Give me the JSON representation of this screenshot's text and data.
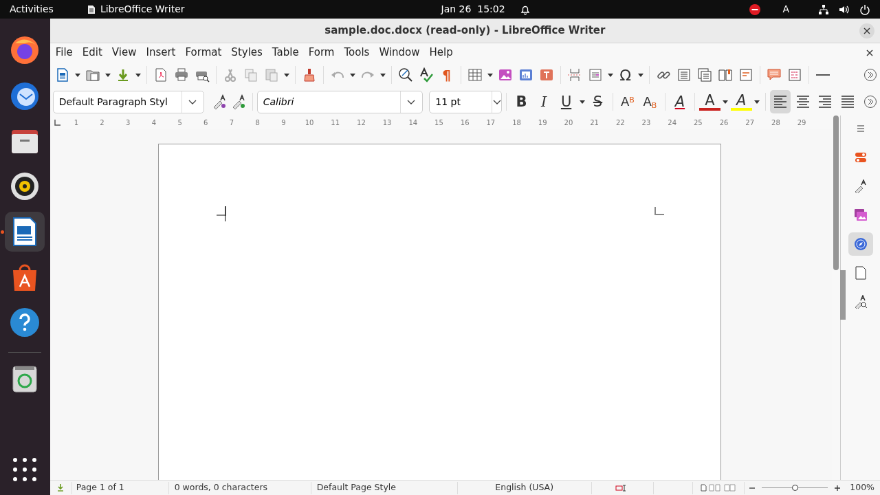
{
  "top_bar": {
    "activities": "Activities",
    "app_name": "LibreOffice Writer",
    "date": "Jan 26",
    "time": "15:02",
    "input_source": "A"
  },
  "dock": [
    {
      "kind": "browser",
      "running": false
    },
    {
      "kind": "mail",
      "running": false
    },
    {
      "kind": "files",
      "running": false
    },
    {
      "kind": "music",
      "running": false
    },
    {
      "kind": "writer",
      "running": true
    },
    {
      "kind": "software",
      "running": false
    },
    {
      "kind": "help",
      "running": false
    },
    {
      "kind": "trash",
      "running": false
    },
    {
      "kind": "apps",
      "running": false
    }
  ],
  "window": {
    "title": "sample.doc.docx (read-only) - LibreOffice Writer"
  },
  "menu": [
    "File",
    "Edit",
    "View",
    "Insert",
    "Format",
    "Styles",
    "Table",
    "Form",
    "Tools",
    "Window",
    "Help"
  ],
  "toolbar_glyphs": {
    "formatting_marks": "¶",
    "special_character": "Ω"
  },
  "formatting": {
    "paragraph_style": "Default Paragraph Styl",
    "font_name": "Calibri",
    "font_size": "11 pt"
  },
  "format_buttons": [
    {
      "kind": "bold",
      "glyph": "B",
      "dropdown": false
    },
    {
      "kind": "italic",
      "glyph": "I",
      "dropdown": false
    },
    {
      "kind": "underline",
      "glyph": "U",
      "dropdown": true
    },
    {
      "kind": "strike",
      "glyph": "S",
      "dropdown": false
    },
    {
      "kind": "superscript",
      "glyph": "A$^{B}$",
      "dropdown": false
    },
    {
      "kind": "subscript",
      "glyph": "A$_{B}$",
      "dropdown": false
    },
    {
      "kind": "clear",
      "glyph": "A",
      "dropdown": false
    },
    {
      "kind": "font-color",
      "glyph": "A",
      "dropdown": true
    },
    {
      "kind": "highlight",
      "glyph": "A",
      "dropdown": true
    }
  ],
  "alignment": [
    {
      "kind": "left",
      "selected": true
    },
    {
      "kind": "center",
      "selected": false
    },
    {
      "kind": "right",
      "selected": false
    },
    {
      "kind": "justify",
      "selected": false
    }
  ],
  "ruler": [
    "1",
    "2",
    "3",
    "4",
    "5",
    "6",
    "7",
    "8",
    "9",
    "10",
    "11",
    "12",
    "13",
    "14",
    "15",
    "16",
    "17",
    "18",
    "19",
    "20",
    "21",
    "22",
    "23",
    "24",
    "25",
    "26",
    "27",
    "28",
    "29"
  ],
  "sidebar": [
    {
      "kind": "menu",
      "selected": false
    },
    {
      "kind": "properties",
      "selected": false
    },
    {
      "kind": "styles",
      "selected": false
    },
    {
      "kind": "gallery",
      "selected": false
    },
    {
      "kind": "navigator",
      "selected": true
    },
    {
      "kind": "page",
      "selected": false
    },
    {
      "kind": "style-inspector",
      "selected": false
    }
  ],
  "status_bar": {
    "page": "Page 1 of 1",
    "word_count": "0 words, 0 characters",
    "page_style": "Default Page Style",
    "language": "English (USA)",
    "zoom": "100%",
    "zoom_slider": {
      "level": 0.5
    }
  }
}
